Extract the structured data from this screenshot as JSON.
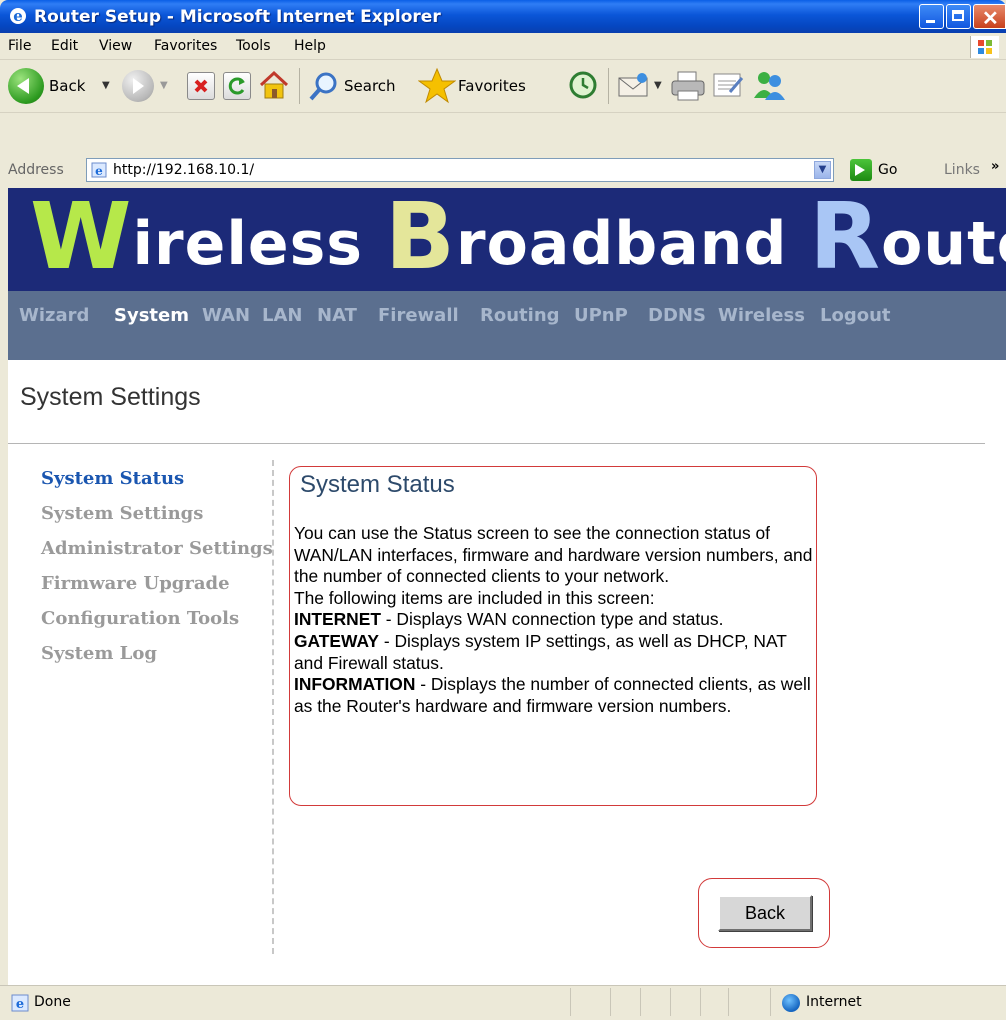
{
  "window": {
    "title": "Router Setup - Microsoft Internet Explorer"
  },
  "menu": [
    "File",
    "Edit",
    "View",
    "Favorites",
    "Tools",
    "Help"
  ],
  "toolbar": {
    "back_label": "Back",
    "search_label": "Search",
    "favorites_label": "Favorites"
  },
  "address": {
    "label": "Address",
    "url": "http://192.168.10.1/",
    "go_label": "Go",
    "links_label": "Links"
  },
  "banner": {
    "w1_cap": "W",
    "w1_rest": "ireless",
    "w2_cap": "B",
    "w2_rest": "roadband",
    "w3_cap": "R",
    "w3_rest": "outer"
  },
  "nav": [
    "Wizard",
    "System",
    "WAN",
    "LAN",
    "NAT",
    "Firewall",
    "Routing",
    "UPnP",
    "DDNS",
    "Wireless",
    "Logout"
  ],
  "page": {
    "section_title": "System Settings"
  },
  "sidebar": [
    "System Status",
    "System Settings",
    "Administrator Settings",
    "Firmware Upgrade",
    "Configuration Tools",
    "System Log"
  ],
  "help": {
    "title": "System Status",
    "intro": "You can use the Status screen to see the connection status of WAN/LAN interfaces, firmware and hardware version numbers, and the number of connected clients to your network.",
    "items_intro": "The following items are included in this screen:",
    "item1_term": "INTERNET",
    "item1_desc": " - Displays WAN connection type and status.",
    "item2_term": "GATEWAY",
    "item2_desc": " - Displays system IP settings, as well as DHCP, NAT and Firewall status.",
    "item3_term": "INFORMATION",
    "item3_desc": " - Displays the number of connected clients, as well as the Router's hardware and firmware version numbers."
  },
  "buttons": {
    "back": "Back"
  },
  "status": {
    "text": "Done",
    "zone": "Internet"
  }
}
